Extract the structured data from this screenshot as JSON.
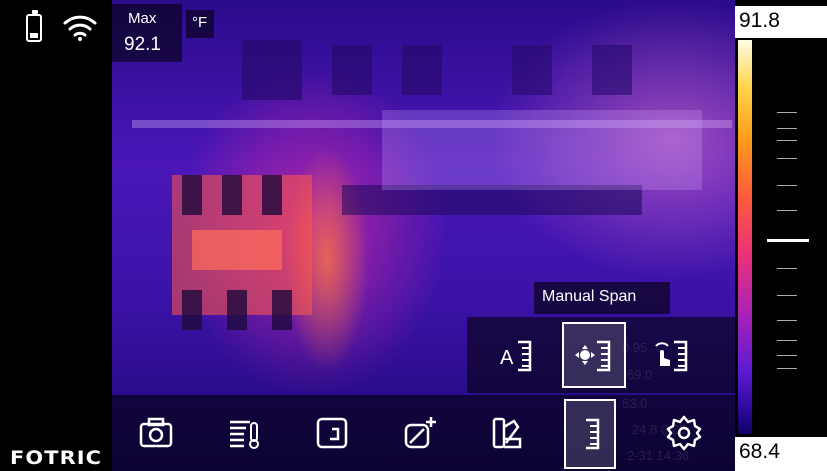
{
  "status": {
    "battery_icon": "battery-icon",
    "wifi_icon": "wifi-icon"
  },
  "brand": "FOTRIC",
  "measurement": {
    "max_label": "Max",
    "max_value": "92.1",
    "unit": "°F"
  },
  "palette": {
    "top_value": "91.8",
    "bottom_value": "68.4"
  },
  "span_menu": {
    "tooltip": "Manual Span",
    "options": [
      {
        "name": "auto-span",
        "icon": "auto-span-icon"
      },
      {
        "name": "manual-span",
        "icon": "manual-span-icon",
        "selected": true
      },
      {
        "name": "touch-span",
        "icon": "touch-span-icon"
      }
    ]
  },
  "toolbar": {
    "items": [
      {
        "name": "camera",
        "icon": "camera-icon"
      },
      {
        "name": "measure-list",
        "icon": "measure-list-icon"
      },
      {
        "name": "image-mode",
        "icon": "image-mode-icon"
      },
      {
        "name": "add-analysis",
        "icon": "add-analysis-icon"
      },
      {
        "name": "palette",
        "icon": "palette-icon"
      },
      {
        "name": "span",
        "icon": "span-icon",
        "selected": true
      },
      {
        "name": "settings",
        "icon": "gear-icon"
      }
    ]
  },
  "colors": {
    "thermal_base": "#3a12a6",
    "hot": "#ff5a3c"
  }
}
